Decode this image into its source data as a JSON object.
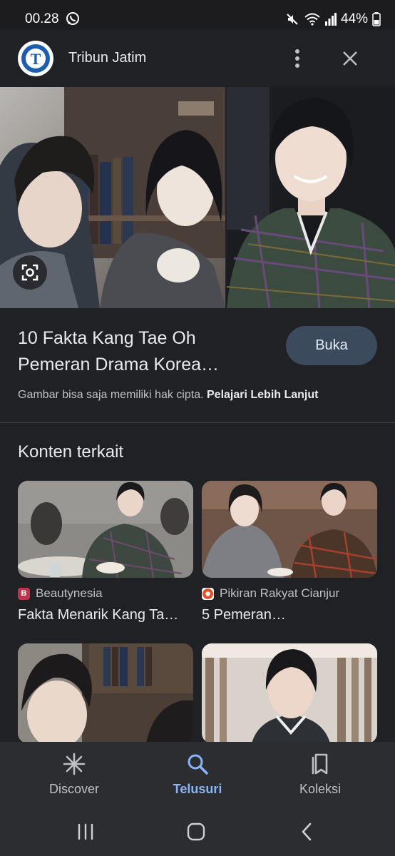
{
  "status_bar": {
    "time": "00.28",
    "battery": "44%"
  },
  "header": {
    "site_name": "Tribun Jatim",
    "logo_letter": "T"
  },
  "result": {
    "title_line1": "10 Fakta Kang Tae Oh",
    "title_line2": "Pemeran Drama Korea…",
    "open_label": "Buka",
    "copyright_text": "Gambar bisa saja memiliki hak cipta.",
    "learn_more": "Pelajari Lebih Lanjut"
  },
  "related": {
    "heading": "Konten terkait",
    "cards": [
      {
        "source": "Beautynesia",
        "title": "Fakta Menarik Kang Ta…",
        "favicon": "B",
        "favicon_color": "#c2334d"
      },
      {
        "source": "Pikiran Rakyat Cianjur",
        "title": "5 Pemeran…",
        "favicon": "",
        "favicon_color": "#e2532b"
      }
    ]
  },
  "bottom_nav": {
    "items": [
      {
        "label": "Discover",
        "icon": "asterisk-icon",
        "active": false
      },
      {
        "label": "Telusuri",
        "icon": "search-icon",
        "active": true
      },
      {
        "label": "Koleksi",
        "icon": "collections-icon",
        "active": false
      }
    ]
  },
  "colors": {
    "background": "#202124",
    "accent": "#8ab4f8",
    "button_bg": "#3c4a5e"
  }
}
